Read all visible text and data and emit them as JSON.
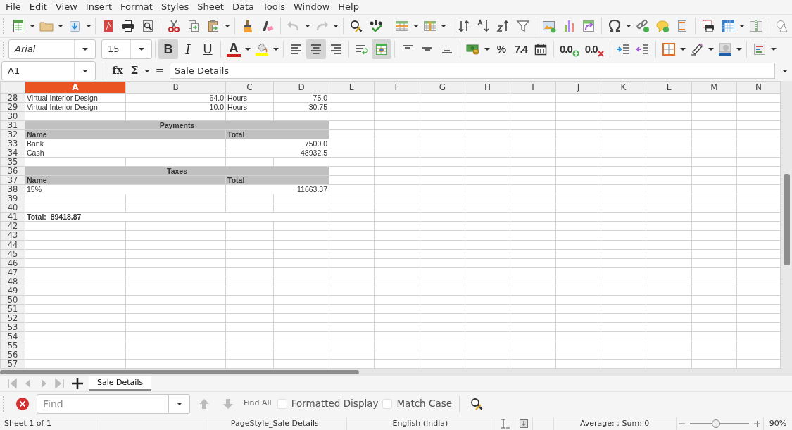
{
  "menu": [
    "File",
    "Edit",
    "View",
    "Insert",
    "Format",
    "Styles",
    "Sheet",
    "Data",
    "Tools",
    "Window",
    "Help"
  ],
  "standard_toolbar": {
    "undo": {
      "disabled": true
    },
    "redo": {
      "disabled": true
    }
  },
  "formatting_toolbar": {
    "font_name": "Arial",
    "font_size": "15",
    "bold": {
      "label": "B",
      "on": true
    },
    "italic": {
      "label": "I",
      "on": false
    },
    "underline": {
      "label": "U",
      "on": false
    },
    "font_color": {
      "label": "A"
    },
    "align_left": {
      "on": false
    },
    "align_center": {
      "on": true
    },
    "align_right": {
      "on": false
    },
    "wrap_text": {
      "on": false
    },
    "merge_and_center": {
      "on": true
    },
    "percent": {
      "label": "%"
    },
    "number": {
      "label": "7.4"
    },
    "add_decimal": {
      "label": "0.0"
    },
    "delete_decimal": {
      "label": "0.0"
    }
  },
  "formula_bar": {
    "cell_reference": "A1",
    "function_wizard": "fx",
    "sum": "Σ",
    "formula": "=",
    "content": "Sale Details"
  },
  "sheet": {
    "columns": [
      {
        "label": "A",
        "selected": true
      },
      {
        "label": "B",
        "selected": false
      },
      {
        "label": "C",
        "selected": false
      },
      {
        "label": "D",
        "selected": false
      },
      {
        "label": "E",
        "selected": false
      },
      {
        "label": "F",
        "selected": false
      },
      {
        "label": "G",
        "selected": false
      },
      {
        "label": "H",
        "selected": false
      },
      {
        "label": "I",
        "selected": false
      },
      {
        "label": "J",
        "selected": false
      },
      {
        "label": "K",
        "selected": false
      },
      {
        "label": "L",
        "selected": false
      },
      {
        "label": "M",
        "selected": false
      },
      {
        "label": "N",
        "selected": false
      }
    ],
    "rows": [
      {
        "number": "28",
        "kind": "item",
        "cells": [
          "Virtual Interior Design",
          "64.0",
          "Hours",
          "75.0"
        ]
      },
      {
        "number": "29",
        "kind": "item",
        "cells": [
          "Virtual Interior Design",
          "10.0",
          "Hours",
          "30.75"
        ]
      },
      {
        "number": "30",
        "kind": "empty"
      },
      {
        "number": "31",
        "kind": "section",
        "cells": [
          "Payments"
        ]
      },
      {
        "number": "32",
        "kind": "header",
        "cells": [
          "Name",
          "Total"
        ]
      },
      {
        "number": "33",
        "kind": "entry",
        "cells": [
          "Bank",
          "7500.0"
        ]
      },
      {
        "number": "34",
        "kind": "entry",
        "cells": [
          "Cash",
          "48932.5"
        ]
      },
      {
        "number": "35",
        "kind": "empty"
      },
      {
        "number": "36",
        "kind": "section",
        "cells": [
          "Taxes"
        ]
      },
      {
        "number": "37",
        "kind": "header",
        "cells": [
          "Name",
          "Total"
        ]
      },
      {
        "number": "38",
        "kind": "entry",
        "cells": [
          "15%",
          "11663.37"
        ]
      },
      {
        "number": "39",
        "kind": "empty"
      },
      {
        "number": "40",
        "kind": "empty"
      },
      {
        "number": "41",
        "kind": "total",
        "cells": [
          "Total:  89418.87"
        ]
      },
      {
        "number": "42",
        "kind": "empty"
      },
      {
        "number": "43",
        "kind": "empty"
      },
      {
        "number": "44",
        "kind": "empty"
      },
      {
        "number": "45",
        "kind": "empty"
      },
      {
        "number": "46",
        "kind": "empty"
      },
      {
        "number": "47",
        "kind": "empty"
      },
      {
        "number": "48",
        "kind": "empty"
      },
      {
        "number": "49",
        "kind": "empty"
      },
      {
        "number": "50",
        "kind": "empty"
      },
      {
        "number": "51",
        "kind": "empty"
      },
      {
        "number": "52",
        "kind": "empty"
      },
      {
        "number": "53",
        "kind": "empty"
      },
      {
        "number": "54",
        "kind": "empty"
      },
      {
        "number": "55",
        "kind": "empty"
      },
      {
        "number": "56",
        "kind": "empty"
      },
      {
        "number": "57",
        "kind": "empty"
      }
    ]
  },
  "sheet_tabs": [
    {
      "label": "Sale Details",
      "selected": true
    }
  ],
  "find_toolbar": {
    "placeholder": "Find",
    "find_all": "Find All",
    "options": [
      {
        "label": "Formatted Display",
        "checked": false
      },
      {
        "label": "Match Case",
        "checked": false
      }
    ]
  },
  "status_bar": {
    "sheet": "Sheet 1 of 1",
    "page_style": "PageStyle_Sale Details",
    "language": "English (India)",
    "selection": "Average: ; Sum: 0",
    "zoom": {
      "level": 0.43,
      "reading": "90%"
    }
  }
}
